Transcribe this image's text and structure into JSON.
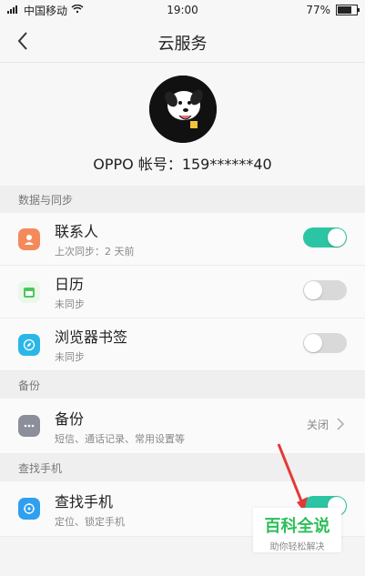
{
  "status_bar": {
    "carrier": "中国移动",
    "time": "19:00",
    "battery": "77%"
  },
  "header": {
    "title": "云服务"
  },
  "profile": {
    "account_label": "OPPO 帐号：159******40"
  },
  "sections": {
    "sync": {
      "title": "数据与同步",
      "items": [
        {
          "label": "联系人",
          "sub": "上次同步：2 天前"
        },
        {
          "label": "日历",
          "sub": "未同步"
        },
        {
          "label": "浏览器书签",
          "sub": "未同步"
        }
      ]
    },
    "backup": {
      "title": "备份",
      "item": {
        "label": "备份",
        "sub": "短信、通话记录、常用设置等",
        "status": "关闭"
      }
    },
    "findphone": {
      "title": "查找手机",
      "item": {
        "label": "查找手机",
        "sub": "定位、锁定手机"
      }
    }
  },
  "watermark": {
    "title": "百科全说",
    "subtitle": "助你轻松解决"
  },
  "colors": {
    "accent": "#2cc5a3",
    "contacts": "#f48a5c",
    "calendar": "#4cc75e",
    "browser": "#2ab7e8",
    "backup": "#8b8f99",
    "find": "#2f9ff0"
  }
}
